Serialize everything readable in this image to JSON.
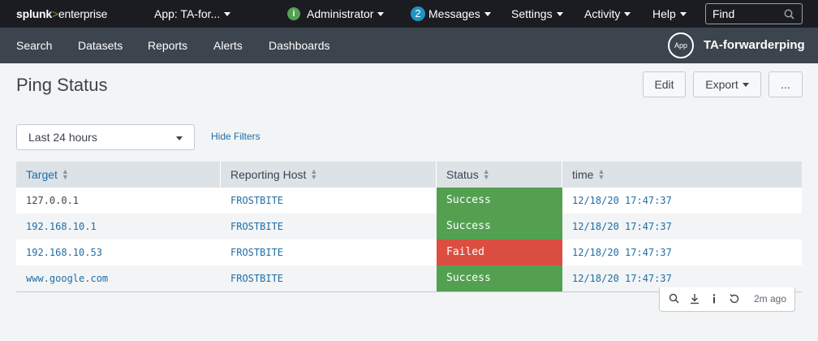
{
  "topbar": {
    "logo_main": "splunk",
    "logo_sep": ">",
    "logo_product": "enterprise",
    "app_menu": "App: TA-for...",
    "user_badge": "i",
    "user": "Administrator",
    "messages_count": "2",
    "messages": "Messages",
    "settings": "Settings",
    "activity": "Activity",
    "help": "Help",
    "find_placeholder": "Find"
  },
  "appbar": {
    "nav": [
      "Search",
      "Datasets",
      "Reports",
      "Alerts",
      "Dashboards"
    ],
    "app_icon": "App",
    "app_name": "TA-forwarderping"
  },
  "dashboard": {
    "title": "Ping Status",
    "edit": "Edit",
    "export": "Export",
    "more": "..."
  },
  "filters": {
    "time_range": "Last 24 hours",
    "hide_filters": "Hide Filters"
  },
  "table": {
    "columns": [
      "Target",
      "Reporting Host",
      "Status",
      "time"
    ],
    "rows": [
      {
        "target": "127.0.0.1",
        "host": "FROSTBITE",
        "status": "Success",
        "time": "12/18/20 17:47:37"
      },
      {
        "target": "192.168.10.1",
        "host": "FROSTBITE",
        "status": "Success",
        "time": "12/18/20 17:47:37"
      },
      {
        "target": "192.168.10.53",
        "host": "FROSTBITE",
        "status": "Failed",
        "time": "12/18/20 17:47:37"
      },
      {
        "target": "www.google.com",
        "host": "FROSTBITE",
        "status": "Success",
        "time": "12/18/20 17:47:37"
      }
    ]
  },
  "footer": {
    "icons": [
      "search-icon",
      "download-icon",
      "info-icon",
      "refresh-icon"
    ],
    "last_updated": "2m ago"
  },
  "colors": {
    "success": "#53a051",
    "failed": "#dc4e41",
    "topbar": "#1a1c21",
    "appbar": "#3c444d",
    "link": "#1e6ea7"
  }
}
